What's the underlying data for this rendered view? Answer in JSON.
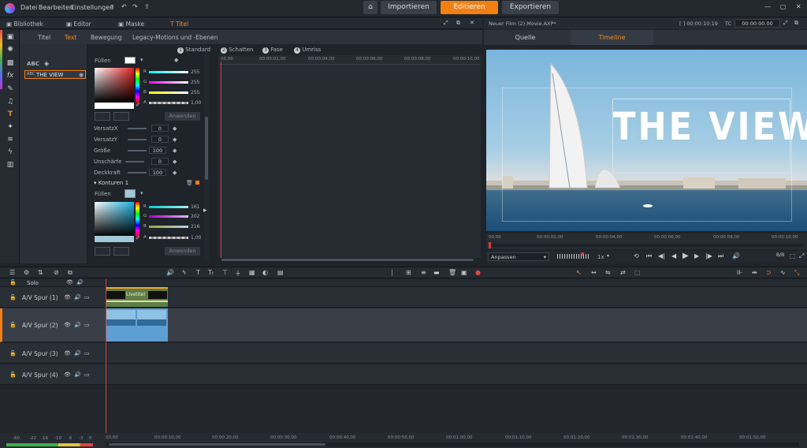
{
  "menu": {
    "datei": "Datei",
    "bearbeiten": "Bearbeiten",
    "einstellungen": "Einstellungen"
  },
  "modes": {
    "import": "Importieren",
    "edit": "Editieren",
    "export": "Exportieren"
  },
  "left_tabs": {
    "library": "Bibliothek",
    "editor": "Editor",
    "mask": "Maske",
    "title": "Titel"
  },
  "sub_tabs": {
    "titel": "Titel",
    "text": "Text",
    "bewegung": "Bewegung",
    "legacy": "Legacy-Motions und -Ebenen"
  },
  "style_tabs": [
    {
      "num": "1",
      "label": "Standard"
    },
    {
      "num": "2",
      "label": "Schatten"
    },
    {
      "num": "3",
      "label": "Fase"
    },
    {
      "num": "4",
      "label": "Umriss"
    }
  ],
  "layer_list": {
    "abc_label": "ABC",
    "layer_name": "THE VIEW"
  },
  "fill": {
    "label": "Füllen",
    "r": "255",
    "g": "255",
    "b": "255",
    "a": "1,00",
    "apply": "Anwenden"
  },
  "props": [
    {
      "label": "VersatzX",
      "value": "0"
    },
    {
      "label": "VersatzY",
      "value": "0"
    },
    {
      "label": "Größe",
      "value": "100"
    },
    {
      "label": "Unschärfe",
      "value": "0"
    },
    {
      "label": "Deckkraft",
      "value": "100"
    }
  ],
  "contour": {
    "section": "Konturen 1",
    "label": "Füllen",
    "r": "161",
    "g": "202",
    "b": "216",
    "a": "1,00",
    "apply": "Anwenden"
  },
  "title_ruler": [
    "00,00",
    "00:00:02,00",
    "00:00:04,00",
    "00:00:06,00",
    "00:00:08,00",
    "00:00:10,00"
  ],
  "preview": {
    "project": "Neuer Film (2).Movie.AXP*",
    "tc_left": "[ ] 00:00:10:19",
    "tc_label": "TC",
    "tc_right": "00:00:00.00",
    "tab_source": "Quelle",
    "tab_timeline": "Timeline",
    "overlay_text": "THE VIEW",
    "ruler": [
      "00,00",
      "00:00:02,00",
      "00:00:04,00",
      "00:00:06,00",
      "00:00:08,00",
      "00:00:10,00"
    ],
    "fit": "Anpassen",
    "speed": "1x"
  },
  "tracks": [
    {
      "name": "Solo"
    },
    {
      "name": "A/V Spur (1)"
    },
    {
      "name": "A/V Spur (2)"
    },
    {
      "name": "A/V Spur (3)"
    },
    {
      "name": "A/V Spur (4)"
    }
  ],
  "clips": {
    "title_clip": "Livetitel"
  },
  "timeline_ruler": [
    "00,00",
    "00:00:10,00",
    "00:00:20,00",
    "00:00:30,00",
    "00:00:40,00",
    "00:00:50,00",
    "00:01:00,00",
    "00:01:10,00",
    "00:01:20,00",
    "00:01:30,00",
    "00:01:40,00",
    "00:01:50,00"
  ],
  "meter_ticks": [
    "-60",
    "-22",
    "-16",
    "-10",
    "-6",
    "-3",
    "0"
  ],
  "colors": {
    "accent": "#f27f12",
    "panel": "#2b3038",
    "bg": "#1f232a"
  }
}
